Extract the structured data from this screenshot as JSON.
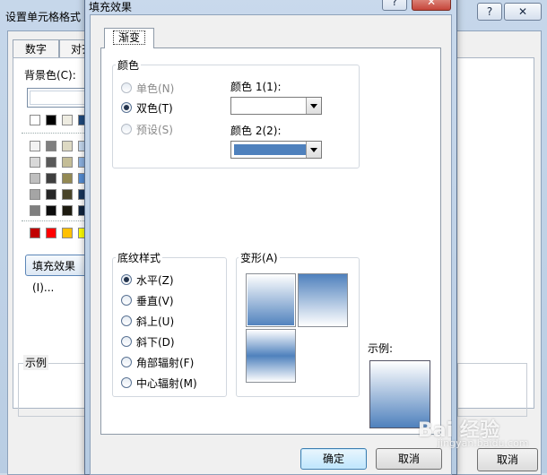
{
  "outer_dialog": {
    "title": "设置单元格格式",
    "help_button": "?",
    "close_button": "✕",
    "tabs": [
      "数字",
      "对齐"
    ],
    "bgcolor_label": "背景色(C):",
    "fill_effects_button": "填充效果(I)...",
    "sample_label": "示例",
    "cancel_button": "取消"
  },
  "fill_dialog": {
    "title": "填充效果",
    "help_button": "?",
    "close_button": "✕",
    "tab": "渐变",
    "colors_group": {
      "label": "颜色",
      "options": [
        {
          "label": "单色(N)",
          "selected": false,
          "disabled": true
        },
        {
          "label": "双色(T)",
          "selected": true,
          "disabled": false
        },
        {
          "label": "预设(S)",
          "selected": false,
          "disabled": true
        }
      ],
      "color1_label": "颜色 1(1):",
      "color1_value": "#ffffff",
      "color2_label": "颜色 2(2):",
      "color2_value": "#4f81bd"
    },
    "shading_group": {
      "label": "底纹样式",
      "options": [
        {
          "label": "水平(Z)",
          "selected": true
        },
        {
          "label": "垂直(V)",
          "selected": false
        },
        {
          "label": "斜上(U)",
          "selected": false
        },
        {
          "label": "斜下(D)",
          "selected": false
        },
        {
          "label": "角部辐射(F)",
          "selected": false
        },
        {
          "label": "中心辐射(M)",
          "selected": false
        }
      ]
    },
    "variants_label": "变形(A)",
    "sample_label": "示例:",
    "ok_button": "确定",
    "cancel_button": "取消"
  },
  "watermark": {
    "text": "Bai 经验",
    "sub": "jingyan.baidu.com"
  },
  "colors": {
    "accent_blue": "#4f81bd",
    "white": "#ffffff",
    "palette_rows": [
      [
        "#ffffff",
        "#000000",
        "#eeece1",
        "#1f497d"
      ],
      [
        "#f2f2f2",
        "#7f7f7f",
        "#ddd9c3",
        "#c6d9f0"
      ],
      [
        "#d8d8d8",
        "#595959",
        "#c4bd97",
        "#8db3e2"
      ],
      [
        "#bfbfbf",
        "#3f3f3f",
        "#938953",
        "#548dd4"
      ],
      [
        "#a5a5a5",
        "#262626",
        "#494429",
        "#17365d"
      ],
      [
        "#7f7f7f",
        "#0c0c0c",
        "#1d1b10",
        "#0f243e"
      ],
      [
        "#c00000",
        "#ff0000",
        "#ffc000",
        "#ffff00"
      ]
    ]
  }
}
